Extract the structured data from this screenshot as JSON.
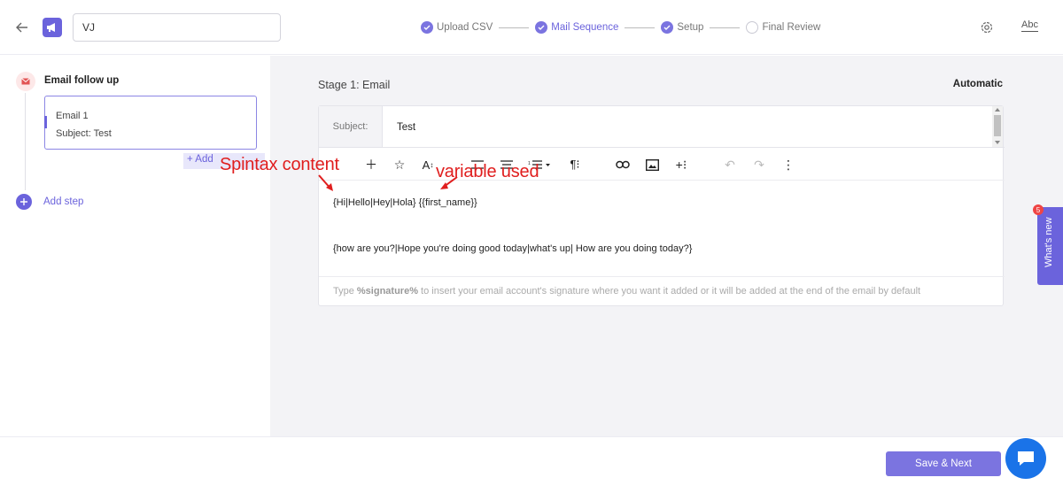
{
  "header": {
    "campaign_name": "VJ",
    "steps": [
      {
        "label": "Upload CSV",
        "state": "done"
      },
      {
        "label": "Mail Sequence",
        "state": "active"
      },
      {
        "label": "Setup",
        "state": "done"
      },
      {
        "label": "Final Review",
        "state": "pending"
      }
    ],
    "text_format_label": "Abc"
  },
  "sidebar": {
    "sequence_title": "Email follow up",
    "email_card": {
      "name": "Email 1",
      "subject": "Subject: Test"
    },
    "add_variant_label": "+ Add",
    "add_step_label": "Add step"
  },
  "main": {
    "stage_title": "Stage 1: Email",
    "mode_label": "Automatic",
    "subject_label": "Subject:",
    "subject_value": "Test",
    "body_line_1": "{Hi|Hello|Hey|Hola} {{first_name}}",
    "body_line_2": "{how are you?|Hope you're doing good today|what's up| How are you doing today?}",
    "signature_hint_pre": "Type ",
    "signature_hint_token": "%signature%",
    "signature_hint_post": " to insert your email account's signature where you want it added or it will be added at the end of the email by default"
  },
  "annotations": {
    "spintax": "Spintax content",
    "variable": "variable used"
  },
  "whats_new": {
    "label": "What's new",
    "count": "5"
  },
  "footer": {
    "save_label": "Save & Next"
  },
  "colors": {
    "accent": "#6b63dc",
    "annotation": "#e01e1e",
    "chat": "#1a73e8"
  }
}
